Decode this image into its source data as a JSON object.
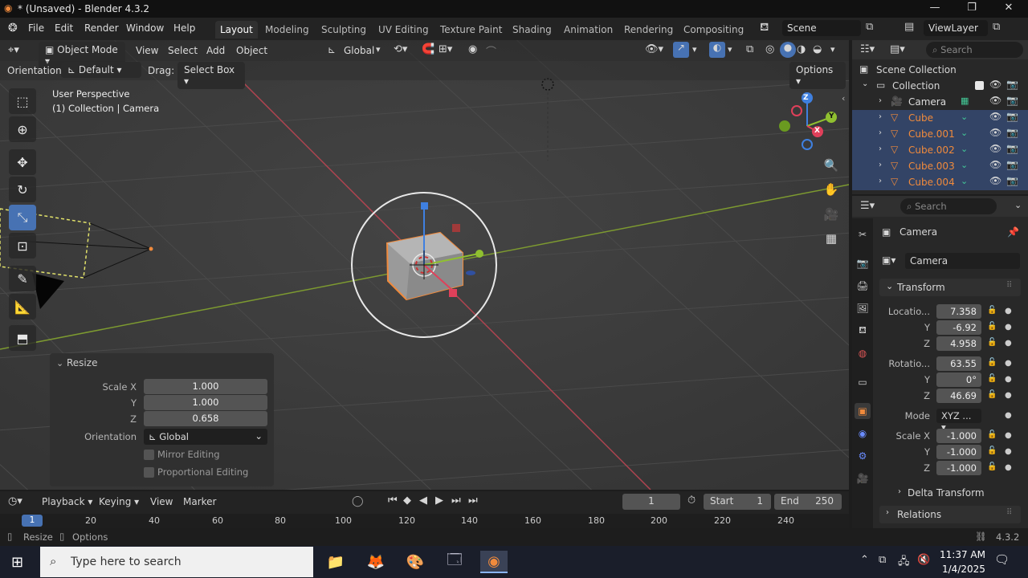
{
  "window": {
    "title": "* (Unsaved) - Blender 4.3.2",
    "minimize": "—",
    "maximize": "❐",
    "close": "✕"
  },
  "menu": [
    "File",
    "Edit",
    "Render",
    "Window",
    "Help"
  ],
  "workspaces": [
    {
      "label": "Layout",
      "active": true
    },
    {
      "label": "Modeling"
    },
    {
      "label": "Sculpting"
    },
    {
      "label": "UV Editing"
    },
    {
      "label": "Texture Paint"
    },
    {
      "label": "Shading"
    },
    {
      "label": "Animation"
    },
    {
      "label": "Rendering"
    },
    {
      "label": "Compositing"
    }
  ],
  "scene": {
    "name": "Scene"
  },
  "view_layer": {
    "name": "ViewLayer"
  },
  "viewport_header": {
    "mode": "Object Mode",
    "menus": [
      "View",
      "Select",
      "Add",
      "Object"
    ],
    "transform_orientation": "Global",
    "orientation_label": "Orientation:",
    "orientation_value": "Default",
    "drag_label": "Drag:",
    "drag_value": "Select Box",
    "options": "Options"
  },
  "viewport_overlay": {
    "perspective": "User Perspective",
    "context": "(1) Collection | Camera"
  },
  "gizmo_axes": {
    "x": "X",
    "y": "Y",
    "z": "Z"
  },
  "resize_panel": {
    "title": "Resize",
    "scale_x_label": "Scale X",
    "scale_x": "1.000",
    "y_label": "Y",
    "scale_y": "1.000",
    "z_label": "Z",
    "scale_z": "0.658",
    "orientation_label": "Orientation",
    "orientation_value": "Global",
    "mirror_editing": "Mirror Editing",
    "proportional_editing": "Proportional Editing"
  },
  "timeline": {
    "menus": [
      "Playback",
      "Keying",
      "View",
      "Marker"
    ],
    "current_frame": "1",
    "start_label": "Start",
    "start": "1",
    "end_label": "End",
    "end": "250",
    "ruler": [
      "1",
      "20",
      "40",
      "60",
      "80",
      "100",
      "120",
      "140",
      "160",
      "180",
      "200",
      "220",
      "240"
    ]
  },
  "statusbar": {
    "left1": "Resize",
    "left2": "Options",
    "version": "4.3.2"
  },
  "outliner": {
    "search_placeholder": "Search",
    "scene_collection": "Scene Collection",
    "collection": "Collection",
    "items": [
      {
        "name": "Camera",
        "selected": false,
        "color": "#dddddd"
      },
      {
        "name": "Cube",
        "selected": true,
        "color": "#f08a3c"
      },
      {
        "name": "Cube.001",
        "selected": true,
        "color": "#f08a3c"
      },
      {
        "name": "Cube.002",
        "selected": true,
        "color": "#f08a3c"
      },
      {
        "name": "Cube.003",
        "selected": true,
        "color": "#f08a3c"
      },
      {
        "name": "Cube.004",
        "selected": true,
        "color": "#f08a3c"
      }
    ]
  },
  "properties": {
    "search_placeholder": "Search",
    "object_name": "Camera",
    "data_name": "Camera",
    "transform_title": "Transform",
    "location_label": "Locatio...",
    "location": [
      "7.358",
      "-6.92",
      "4.958"
    ],
    "rotation_label": "Rotatio...",
    "rotation": [
      "63.55",
      "0°",
      "46.69"
    ],
    "mode_label": "Mode",
    "mode_value": "XYZ ...",
    "scale_label": "Scale X",
    "scale": [
      "-1.000",
      "-1.000",
      "-1.000"
    ],
    "y_label": "Y",
    "z_label": "Z",
    "delta_transform": "Delta Transform",
    "relations": "Relations"
  },
  "taskbar": {
    "search_placeholder": "Type here to search",
    "time": "11:37 AM",
    "date": "1/4/2025"
  },
  "colors": {
    "accent": "#4772b3",
    "selected_orange": "#f08a3c",
    "x_axis": "#e0405a",
    "y_axis": "#90c030",
    "z_axis": "#3f80e0"
  }
}
